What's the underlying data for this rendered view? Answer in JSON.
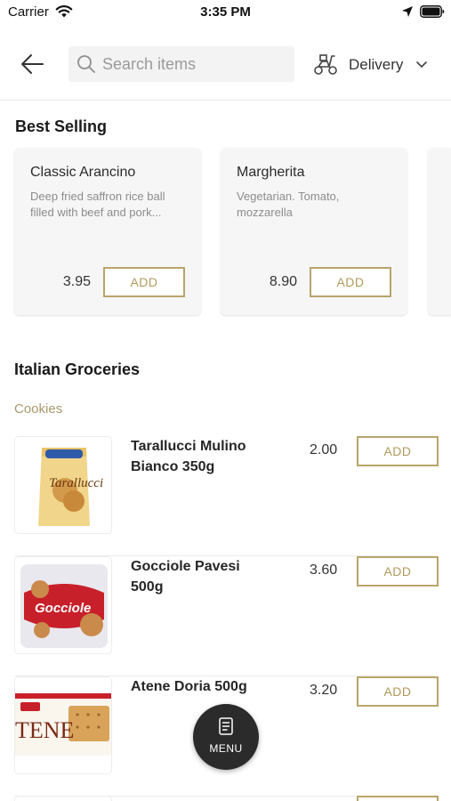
{
  "status_bar": {
    "carrier": "Carrier",
    "time": "3:35 PM"
  },
  "header": {
    "search_placeholder": "Search items",
    "delivery_label": "Delivery"
  },
  "best_selling": {
    "title": "Best Selling",
    "items": [
      {
        "name": "Classic Arancino",
        "description": "Deep fried saffron rice ball filled with beef and pork...",
        "price": "3.95",
        "add_label": "ADD"
      },
      {
        "name": "Margherita",
        "description": "Vegetarian. Tomato, mozzarella",
        "price": "8.90",
        "add_label": "ADD"
      }
    ]
  },
  "groceries": {
    "title": "Italian Groceries",
    "category": "Cookies",
    "items": [
      {
        "name": "Tarallucci Mulino Bianco 350g",
        "price": "2.00",
        "add_label": "ADD",
        "package_text": "Tarallucci"
      },
      {
        "name": "Gocciole Pavesi 500g",
        "price": "3.60",
        "add_label": "ADD",
        "package_text": "Gocciole"
      },
      {
        "name": "Atene Doria 500g",
        "price": "3.20",
        "add_label": "ADD",
        "package_text": "TENE"
      }
    ]
  },
  "menu_button": {
    "label": "MENU"
  },
  "colors": {
    "accent_gold": "#b9a46a",
    "category_gold": "#a8996a",
    "fab": "#2b2b2b"
  }
}
